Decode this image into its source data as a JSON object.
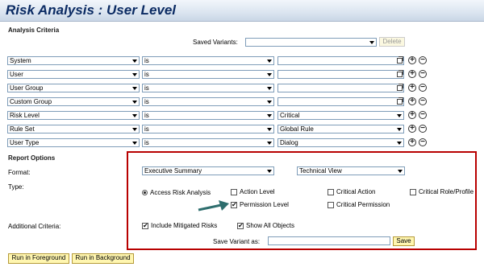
{
  "page_title": "Risk Analysis : User Level",
  "analysis_criteria": {
    "heading": "Analysis Criteria",
    "saved_variants_label": "Saved Variants:",
    "saved_variants_value": "",
    "delete_label": "Delete",
    "rows": [
      {
        "field": "System",
        "operator": "is",
        "value": "",
        "value_type": "text"
      },
      {
        "field": "User",
        "operator": "is",
        "value": "",
        "value_type": "text"
      },
      {
        "field": "User Group",
        "operator": "is",
        "value": "",
        "value_type": "text"
      },
      {
        "field": "Custom Group",
        "operator": "is",
        "value": "",
        "value_type": "text"
      },
      {
        "field": "Risk Level",
        "operator": "is",
        "value": "Critical",
        "value_type": "dropdown"
      },
      {
        "field": "Rule Set",
        "operator": "is",
        "value": "Global Rule",
        "value_type": "dropdown"
      },
      {
        "field": "User Type",
        "operator": "is",
        "value": "Dialog",
        "value_type": "dropdown"
      }
    ],
    "add_symbol": "+",
    "remove_symbol": "−"
  },
  "report_options": {
    "heading": "Report Options",
    "format_label": "Format:",
    "format_value": "Executive Summary",
    "view_value": "Technical View",
    "type_label": "Type:",
    "access_risk_label": "Access Risk Analysis",
    "action_level_label": "Action Level",
    "action_level_checked": false,
    "permission_level_label": "Permission Level",
    "permission_level_checked": true,
    "critical_action_label": "Critical Action",
    "critical_action_checked": false,
    "critical_permission_label": "Critical Permission",
    "critical_permission_checked": false,
    "critical_role_label": "Critical Role/Profile",
    "critical_role_checked": false,
    "additional_criteria_label": "Additional Criteria:",
    "include_mitigated_label": "Include Mitigated Risks",
    "include_mitigated_checked": true,
    "show_all_objects_label": "Show All Objects",
    "show_all_objects_checked": true,
    "save_variant_label": "Save Variant as:",
    "save_variant_value": "",
    "save_label": "Save"
  },
  "footer": {
    "run_foreground_label": "Run in Foreground",
    "run_background_label": "Run in Background"
  },
  "colors": {
    "title_text": "#0b2b63",
    "highlight_border": "#b80000",
    "button_bg": "#fff6b0",
    "arrow": "#2e6e6e"
  },
  "icons": {
    "dropdown": "chevron-down-icon",
    "multi_select": "multiple-selection-icon",
    "add": "plus-circle-icon",
    "remove": "minus-circle-icon",
    "pointer": "arrow-pointer-icon"
  }
}
